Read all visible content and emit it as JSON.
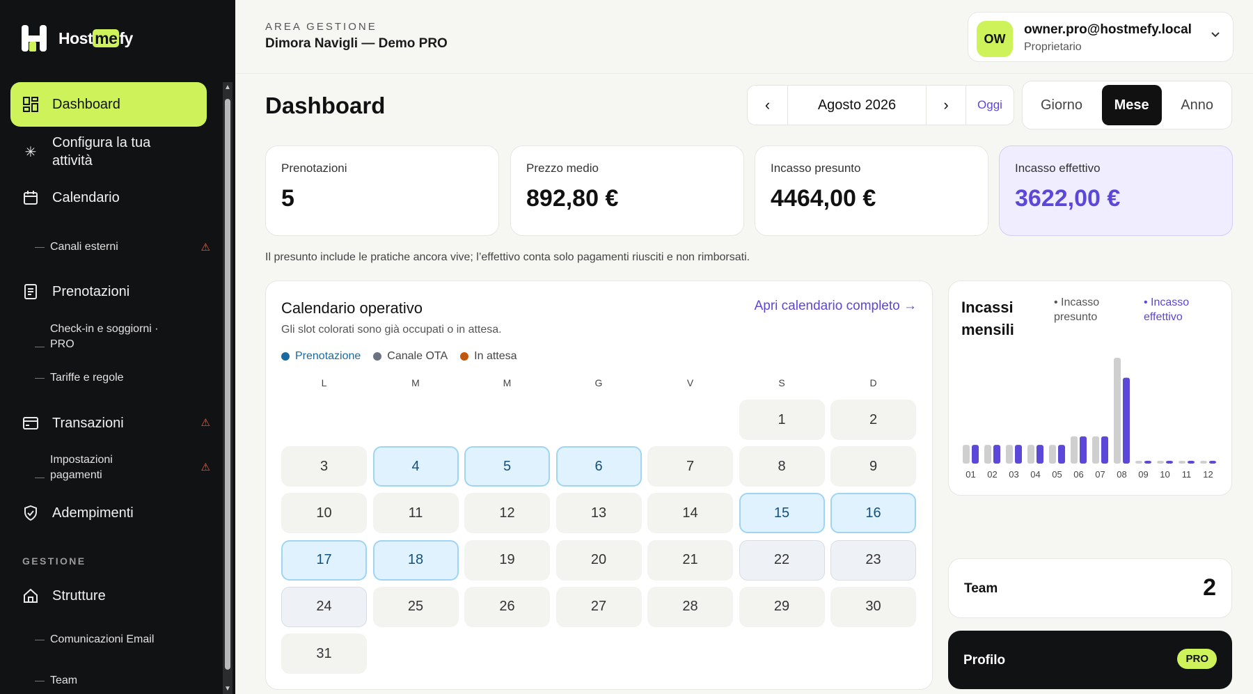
{
  "brand": {
    "name_pre": "Host",
    "name_hl": "me",
    "name_post": "fy"
  },
  "sidebar": {
    "items": [
      {
        "label": "Dashboard",
        "icon": "dashboard-icon"
      },
      {
        "label": "Configura la tua attività",
        "icon": "sparkle-icon"
      },
      {
        "label": "Calendario",
        "icon": "calendar-icon"
      },
      {
        "label": "Canali esterni"
      },
      {
        "label": "Prenotazioni",
        "icon": "document-icon"
      },
      {
        "label": "Check-in e soggiorni · PRO"
      },
      {
        "label": "Tariffe e regole"
      },
      {
        "label": "Transazioni",
        "icon": "card-icon"
      },
      {
        "label": "Impostazioni pagamenti"
      },
      {
        "label": "Adempimenti",
        "icon": "shield-icon"
      }
    ],
    "section": "GESTIONE",
    "section_items": [
      {
        "label": "Strutture",
        "icon": "home-icon"
      },
      {
        "label": "Comunicazioni Email"
      },
      {
        "label": "Team"
      }
    ]
  },
  "header": {
    "area_label": "AREA GESTIONE",
    "area_name": "Dimora Navigli — Demo PRO",
    "user_initials": "OW",
    "user_email": "owner.pro@hostmefy.local",
    "user_role": "Proprietario"
  },
  "page_title": "Dashboard",
  "month_nav": {
    "prev": "‹",
    "label": "Agosto 2026",
    "next": "›",
    "today": "Oggi"
  },
  "views": [
    "Giorno",
    "Mese",
    "Anno"
  ],
  "kpis": [
    {
      "label": "Prenotazioni",
      "value": "5"
    },
    {
      "label": "Prezzo medio",
      "value": "892,80 €"
    },
    {
      "label": "Incasso presunto",
      "value": "4464,00 €"
    },
    {
      "label": "Incasso effettivo",
      "value": "3622,00 €"
    }
  ],
  "note": "Il presunto include le pratiche ancora vive; l’effettivo conta solo pagamenti riusciti e non rimborsati.",
  "calendar": {
    "title": "Calendario operativo",
    "subtitle": "Gli slot colorati sono già occupati o in attesa.",
    "link": "Apri calendario completo →",
    "legend": [
      {
        "label": "Prenotazione",
        "color": "#1a6aa0"
      },
      {
        "label": "Canale OTA",
        "color": "#6b7280"
      },
      {
        "label": "In attesa",
        "color": "#c2570c"
      }
    ],
    "weekdays": [
      "L",
      "M",
      "M",
      "G",
      "V",
      "S",
      "D"
    ],
    "first_weekday_offset": 5,
    "days_in_month": 31,
    "booked_days": [
      4,
      5,
      6,
      15,
      16,
      17,
      18
    ],
    "ota_days": [
      22,
      23,
      24
    ]
  },
  "chart_data": {
    "type": "bar",
    "title": "Incassi mensili",
    "categories": [
      "01",
      "02",
      "03",
      "04",
      "05",
      "06",
      "07",
      "08",
      "09",
      "10",
      "11",
      "12"
    ],
    "series": [
      {
        "name": "Incasso presunto",
        "color": "#cfcfcf",
        "values": [
          790,
          790,
          790,
          790,
          790,
          1150,
          1150,
          4464,
          0,
          0,
          0,
          0
        ]
      },
      {
        "name": "Incasso effettivo",
        "color": "#5b47d8",
        "values": [
          790,
          790,
          790,
          790,
          790,
          1150,
          1150,
          3622,
          0,
          0,
          0,
          0
        ]
      }
    ],
    "ylim": [
      0,
      4464
    ],
    "grid": false,
    "legend": "top"
  },
  "team": {
    "label": "Team",
    "value": "2"
  },
  "profile": {
    "label": "Profilo",
    "badge": "PRO"
  },
  "colors": {
    "accent": "#cdf25a",
    "brand_purple": "#5b47d8",
    "warning": "#ff5a36",
    "sidebar_bg": "#111214"
  }
}
